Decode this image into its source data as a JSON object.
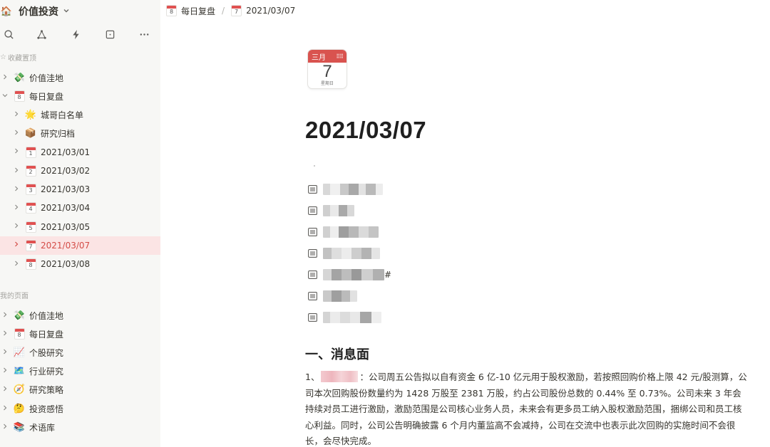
{
  "workspace": {
    "name": "价值投资",
    "icon": "house-emoji-icon"
  },
  "favorites_label": "收藏置顶",
  "favorites": [
    {
      "label": "价值洼地",
      "icon": "money-bag-icon",
      "emoji": "💸"
    },
    {
      "label": "每日复盘",
      "icon": "calendar-icon",
      "cal": "8",
      "expanded": true
    },
    {
      "label": "城哥白名单",
      "icon": "sparkle-icon",
      "emoji": "🌟",
      "indent": 1
    },
    {
      "label": "研究归档",
      "icon": "package-icon",
      "emoji": "📦",
      "indent": 1
    },
    {
      "label": "2021/03/01",
      "icon": "calendar-icon",
      "cal": "1",
      "indent": 1
    },
    {
      "label": "2021/03/02",
      "icon": "calendar-icon",
      "cal": "2",
      "indent": 1
    },
    {
      "label": "2021/03/03",
      "icon": "calendar-icon",
      "cal": "3",
      "indent": 1
    },
    {
      "label": "2021/03/04",
      "icon": "calendar-icon",
      "cal": "4",
      "indent": 1
    },
    {
      "label": "2021/03/05",
      "icon": "calendar-icon",
      "cal": "5",
      "indent": 1
    },
    {
      "label": "2021/03/07",
      "icon": "calendar-icon",
      "cal": "7",
      "indent": 1,
      "active": true
    },
    {
      "label": "2021/03/08",
      "icon": "calendar-icon",
      "cal": "8",
      "indent": 1
    }
  ],
  "pages_label": "我的页面",
  "pages": [
    {
      "label": "价值洼地",
      "icon": "money-bag-icon",
      "emoji": "💸"
    },
    {
      "label": "每日复盘",
      "icon": "calendar-icon",
      "cal": "8"
    },
    {
      "label": "个股研究",
      "icon": "chart-up-icon",
      "emoji": "📈"
    },
    {
      "label": "行业研究",
      "icon": "map-icon",
      "emoji": "🗺️"
    },
    {
      "label": "研究策略",
      "icon": "compass-icon",
      "emoji": "🧭"
    },
    {
      "label": "投资感悟",
      "icon": "thinking-face-icon",
      "emoji": "🤔"
    },
    {
      "label": "术语库",
      "icon": "books-icon",
      "emoji": "📚"
    }
  ],
  "breadcrumb": [
    {
      "label": "每日复盘",
      "cal": "8"
    },
    {
      "label": "2021/03/07",
      "cal": "7"
    }
  ],
  "page": {
    "icon_month": "三月",
    "icon_day": "7",
    "icon_weekday": "星期日",
    "title": "2021/03/07",
    "toc_suffix_5": "#"
  },
  "section_heading": "一、消息面",
  "paragraph": {
    "number": "1、",
    "after_blur": "：公司周五公告拟以自有资金 6 亿-10 亿元用于股权激励，若按照回购价格上限 42 元/股测算，公司本次回购股份数量约为 1428 万股至 2381 万股，约占公司股份总数的 0.44% 至 0.73%。公司未来 3 年会持续对员工进行激励，激励范围是公司核心业务人员，未来会有更多员工纳入股权激励范围，捆绑公司和员工核心利益。同时，公司公告明确披露 6 个月内董监高不会减持，公司在交流中也表示此次回购的实施时间不会很长，会尽快完成。"
  }
}
